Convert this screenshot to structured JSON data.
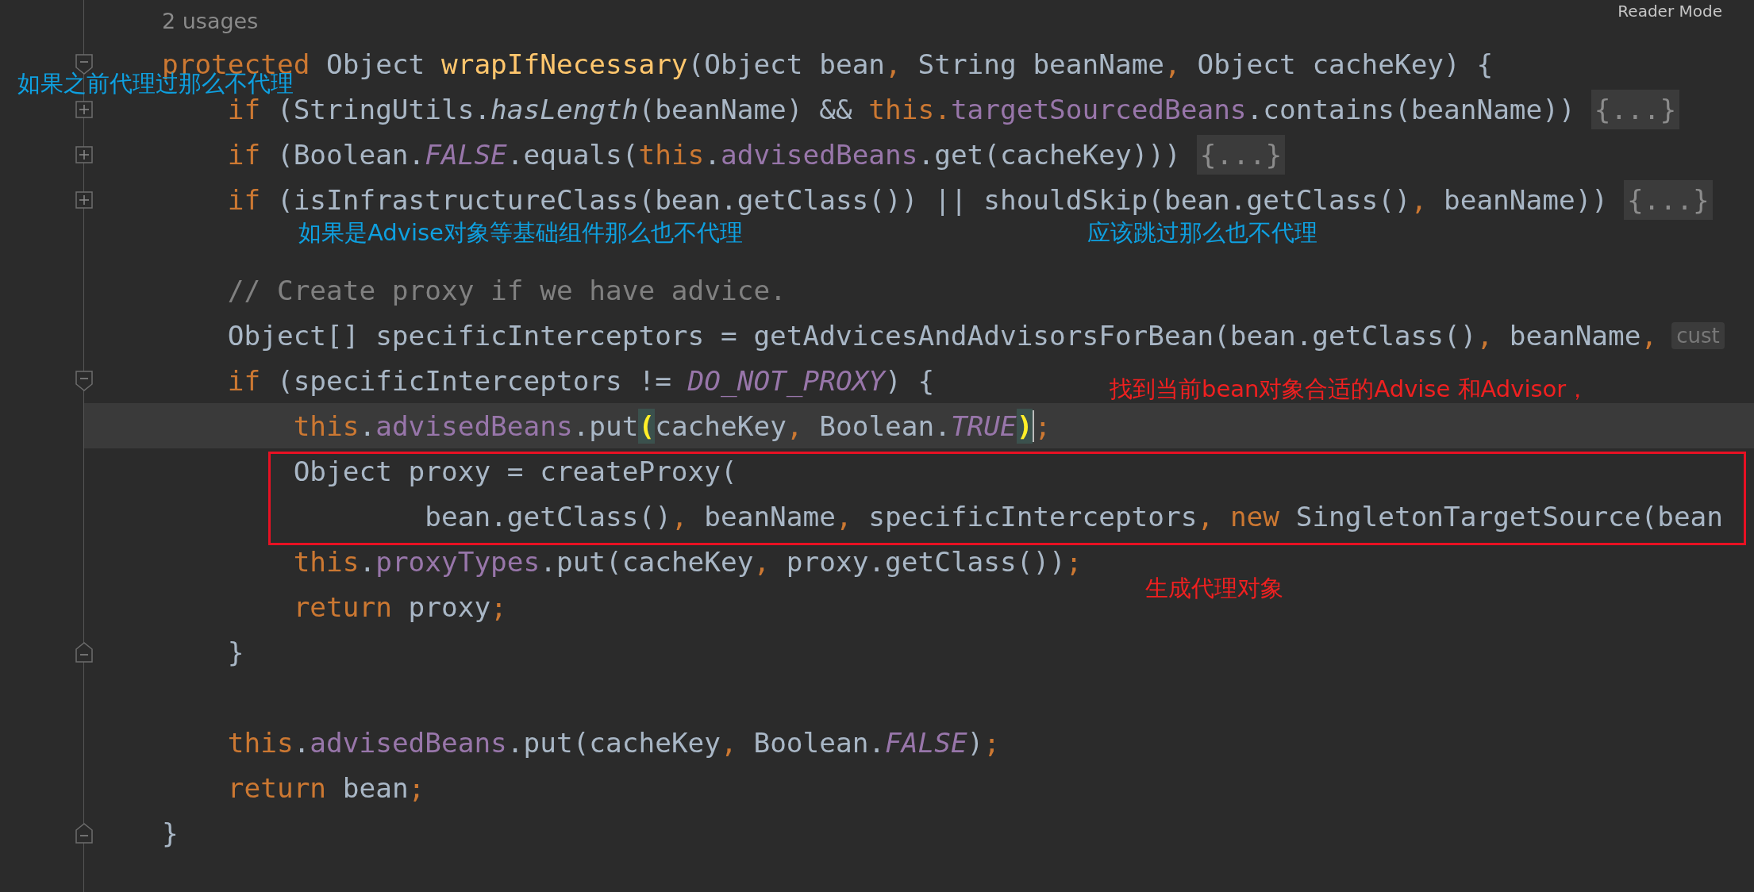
{
  "header": {
    "usages": "2 usages",
    "reader_mode": "Reader Mode"
  },
  "lines": [
    {
      "kind": "code",
      "fold_open": true,
      "tokens": [
        {
          "t": "protected",
          "kind": "kw"
        },
        {
          "t": " Object ",
          "kind": "id"
        },
        {
          "t": "wrapIfNecessary",
          "kind": "decl"
        },
        {
          "t": "(Object bean",
          "kind": "id"
        },
        {
          "t": ", ",
          "kind": "punc"
        },
        {
          "t": "String beanName",
          "kind": "id"
        },
        {
          "t": ", ",
          "kind": "punc"
        },
        {
          "t": "Object cacheKey) {",
          "kind": "id"
        }
      ]
    },
    {
      "kind": "code",
      "folded": "{...}",
      "tokens": [
        {
          "t": "    if",
          "kind": "kw"
        },
        {
          "t": " (StringUtils.",
          "kind": "id"
        },
        {
          "t": "hasLength",
          "kind": "static"
        },
        {
          "t": "(beanName) && ",
          "kind": "id"
        },
        {
          "t": "this.",
          "kind": "kw"
        },
        {
          "t": "targetSourcedBeans",
          "kind": "field"
        },
        {
          "t": ".contains(beanName))",
          "kind": "id"
        }
      ]
    },
    {
      "kind": "code",
      "folded": "{...}",
      "tokens": [
        {
          "t": "    if",
          "kind": "kw"
        },
        {
          "t": " (Boolean.",
          "kind": "id"
        },
        {
          "t": "FALSE",
          "kind": "const"
        },
        {
          "t": ".equals(",
          "kind": "id"
        },
        {
          "t": "this",
          "kind": "kw"
        },
        {
          "t": ".",
          "kind": "id"
        },
        {
          "t": "advisedBeans",
          "kind": "field"
        },
        {
          "t": ".get(cacheKey)))",
          "kind": "id"
        }
      ]
    },
    {
      "kind": "code",
      "folded": "{...}",
      "tokens": [
        {
          "t": "    if",
          "kind": "kw"
        },
        {
          "t": " (isInfrastructureClass(bean.getClass()) || shouldSkip(bean.getClass()",
          "kind": "id"
        },
        {
          "t": ", ",
          "kind": "punc"
        },
        {
          "t": "beanName))",
          "kind": "id"
        }
      ]
    },
    {
      "kind": "blank"
    },
    {
      "kind": "code",
      "tokens": [
        {
          "t": "    // Create proxy if we have advice.",
          "kind": "cmt"
        }
      ]
    },
    {
      "kind": "code",
      "hint": "cust",
      "tokens": [
        {
          "t": "    Object[] specificInterceptors = getAdvicesAndAdvisorsForBean(bean.getClass()",
          "kind": "id"
        },
        {
          "t": ", ",
          "kind": "punc"
        },
        {
          "t": "beanName",
          "kind": "id"
        },
        {
          "t": ",",
          "kind": "punc"
        }
      ]
    },
    {
      "kind": "code",
      "fold_open": true,
      "tokens": [
        {
          "t": "    if",
          "kind": "kw"
        },
        {
          "t": " (specificInterceptors != ",
          "kind": "id"
        },
        {
          "t": "DO_NOT_PROXY",
          "kind": "const"
        },
        {
          "t": ") {",
          "kind": "id"
        }
      ]
    },
    {
      "kind": "code",
      "current": true,
      "tokens": [
        {
          "t": "        this",
          "kind": "kw"
        },
        {
          "t": ".",
          "kind": "id"
        },
        {
          "t": "advisedBeans",
          "kind": "field"
        },
        {
          "t": ".put",
          "kind": "id"
        },
        {
          "t": "(",
          "kind": "match"
        },
        {
          "t": "cacheKey",
          "kind": "id"
        },
        {
          "t": ", ",
          "kind": "punc"
        },
        {
          "t": "Boolean.",
          "kind": "id"
        },
        {
          "t": "TRUE",
          "kind": "const"
        },
        {
          "t": ")",
          "kind": "match",
          "caret": true
        },
        {
          "t": ";",
          "kind": "punc"
        }
      ]
    },
    {
      "kind": "code",
      "boxed": true,
      "tokens": [
        {
          "t": "        Object proxy = createProxy(",
          "kind": "id"
        }
      ]
    },
    {
      "kind": "code",
      "boxed": true,
      "tokens": [
        {
          "t": "                bean.getClass()",
          "kind": "id"
        },
        {
          "t": ", ",
          "kind": "punc"
        },
        {
          "t": "beanName",
          "kind": "id"
        },
        {
          "t": ", ",
          "kind": "punc"
        },
        {
          "t": "specificInterceptors",
          "kind": "id"
        },
        {
          "t": ", ",
          "kind": "punc"
        },
        {
          "t": "new",
          "kind": "kw"
        },
        {
          "t": " SingletonTargetSource(bean",
          "kind": "id"
        }
      ]
    },
    {
      "kind": "code",
      "tokens": [
        {
          "t": "        this",
          "kind": "kw"
        },
        {
          "t": ".",
          "kind": "id"
        },
        {
          "t": "proxyTypes",
          "kind": "field"
        },
        {
          "t": ".put(cacheKey",
          "kind": "id"
        },
        {
          "t": ", ",
          "kind": "punc"
        },
        {
          "t": "proxy.getClass())",
          "kind": "id"
        },
        {
          "t": ";",
          "kind": "punc"
        }
      ]
    },
    {
      "kind": "code",
      "tokens": [
        {
          "t": "        return",
          "kind": "kw"
        },
        {
          "t": " proxy",
          "kind": "id"
        },
        {
          "t": ";",
          "kind": "punc"
        }
      ]
    },
    {
      "kind": "code",
      "fold_end": true,
      "tokens": [
        {
          "t": "    }",
          "kind": "id"
        }
      ]
    },
    {
      "kind": "blank"
    },
    {
      "kind": "code",
      "tokens": [
        {
          "t": "    this",
          "kind": "kw"
        },
        {
          "t": ".",
          "kind": "id"
        },
        {
          "t": "advisedBeans",
          "kind": "field"
        },
        {
          "t": ".put(cacheKey",
          "kind": "id"
        },
        {
          "t": ", ",
          "kind": "punc"
        },
        {
          "t": "Boolean.",
          "kind": "id"
        },
        {
          "t": "FALSE",
          "kind": "const"
        },
        {
          "t": ")",
          "kind": "id"
        },
        {
          "t": ";",
          "kind": "punc"
        }
      ]
    },
    {
      "kind": "code",
      "tokens": [
        {
          "t": "    return",
          "kind": "kw"
        },
        {
          "t": " bean",
          "kind": "id"
        },
        {
          "t": ";",
          "kind": "punc"
        }
      ]
    },
    {
      "kind": "code",
      "fold_end": true,
      "tokens": [
        {
          "t": "}",
          "kind": "id"
        }
      ]
    }
  ],
  "annotations": [
    {
      "text": "如果之前代理过那么不代理",
      "color": "#0ea0e0"
    },
    {
      "text": "如果是Advise对象等基础组件那么也不代理",
      "color": "#0ea0e0"
    },
    {
      "text": "应该跳过那么也不代理",
      "color": "#0ea0e0"
    },
    {
      "text": "找到当前bean对象合适的Advise 和Advisor，",
      "color": "#f02020"
    },
    {
      "text": "生成代理对象",
      "color": "#f02020"
    }
  ],
  "highlight_box": {
    "color": "#e81123"
  }
}
